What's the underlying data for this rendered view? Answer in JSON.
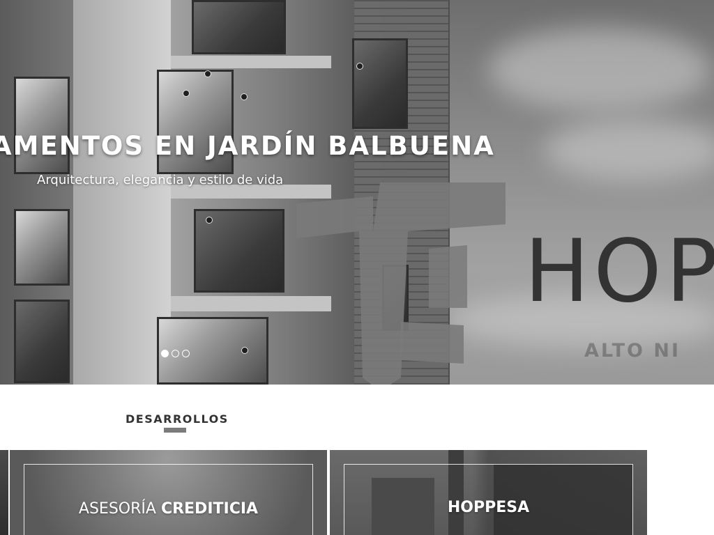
{
  "hero": {
    "title": "AMENTOS EN JARDÍN BALBUENA",
    "subtitle": "Arquitectura, elegancia y estilo de vida",
    "brand": "HOP",
    "tagline": "ALTO NI",
    "slides": 3,
    "active_slide": 1
  },
  "section": {
    "title": "DESARROLLOS"
  },
  "cards": [
    {
      "label_light": "ASESORÍA ",
      "label_bold": "CREDITICIA"
    },
    {
      "label_bold": "HOPPESA"
    }
  ]
}
